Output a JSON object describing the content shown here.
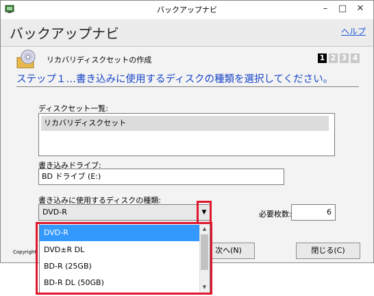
{
  "window": {
    "title": "バックアップナビ"
  },
  "header": {
    "app_title": "バックアップナビ",
    "help_link": "ヘルプ"
  },
  "subheader": {
    "title": "リカバリディスクセットの作成"
  },
  "steps": {
    "items": [
      "1",
      "2",
      "3",
      "4"
    ],
    "active": "1"
  },
  "step_heading": "ステップ１…書き込みに使用するディスクの種類を選択してください。",
  "disc_set": {
    "label": "ディスクセット一覧:",
    "items": [
      "リカバリディスクセット"
    ]
  },
  "drive": {
    "label": "書き込みドライブ:",
    "value": "BD ドライブ (E:)"
  },
  "disc_type": {
    "label": "書き込みに使用するディスクの種類:",
    "value": "DVD-R",
    "options": [
      "DVD-R",
      "DVD±R DL",
      "BD-R (25GB)",
      "BD-R DL (50GB)"
    ]
  },
  "required_count": {
    "label": "必要枚数:",
    "value": "6"
  },
  "footer": {
    "copyright": "Copyright",
    "next_button": "次へ(N)",
    "close_button": "閉じる(C)"
  },
  "colors": {
    "accent_blue": "#1846c8",
    "selection": "#3399ff",
    "highlight_red": "#e0162b"
  }
}
